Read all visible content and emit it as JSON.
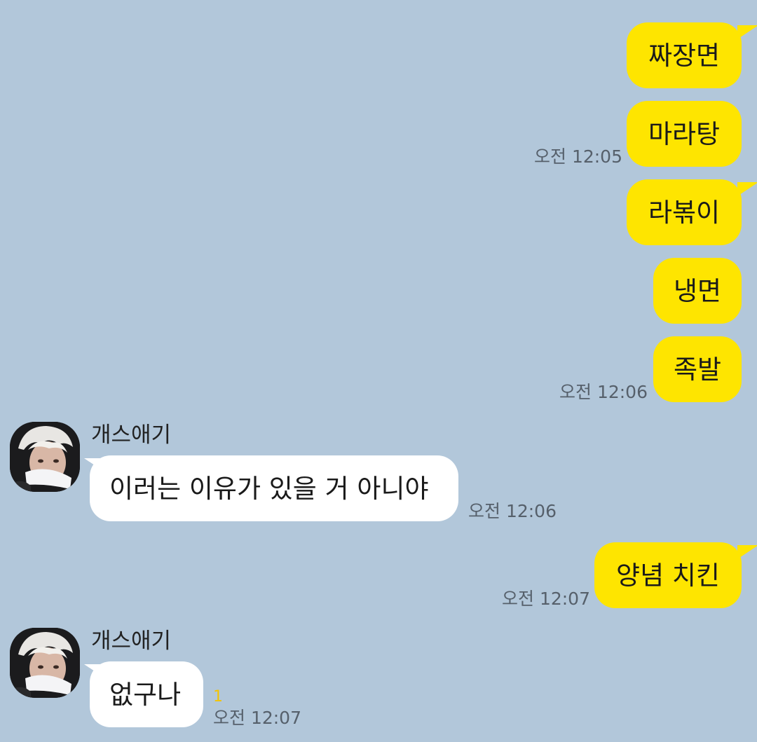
{
  "messages": {
    "m1": {
      "text": "짜장면"
    },
    "m2": {
      "text": "마라탕",
      "time": "오전 12:05"
    },
    "m3": {
      "text": "라볶이"
    },
    "m4": {
      "text": "냉면"
    },
    "m5": {
      "text": "족발",
      "time": "오전 12:06"
    },
    "m6": {
      "sender": "개스애기",
      "text": "이러는 이유가 있을 거 아니야",
      "time": "오전 12:06"
    },
    "m7": {
      "text": "양념 치킨",
      "time": "오전 12:07"
    },
    "m8": {
      "sender": "개스애기",
      "text": "없구나",
      "time": "오전 12:07",
      "unread": "1"
    }
  },
  "icons": {
    "avatar": "profile-photo"
  },
  "colors": {
    "background": "#b2c7da",
    "my_bubble": "#fee500",
    "their_bubble": "#ffffff",
    "unread": "#f4c400"
  }
}
